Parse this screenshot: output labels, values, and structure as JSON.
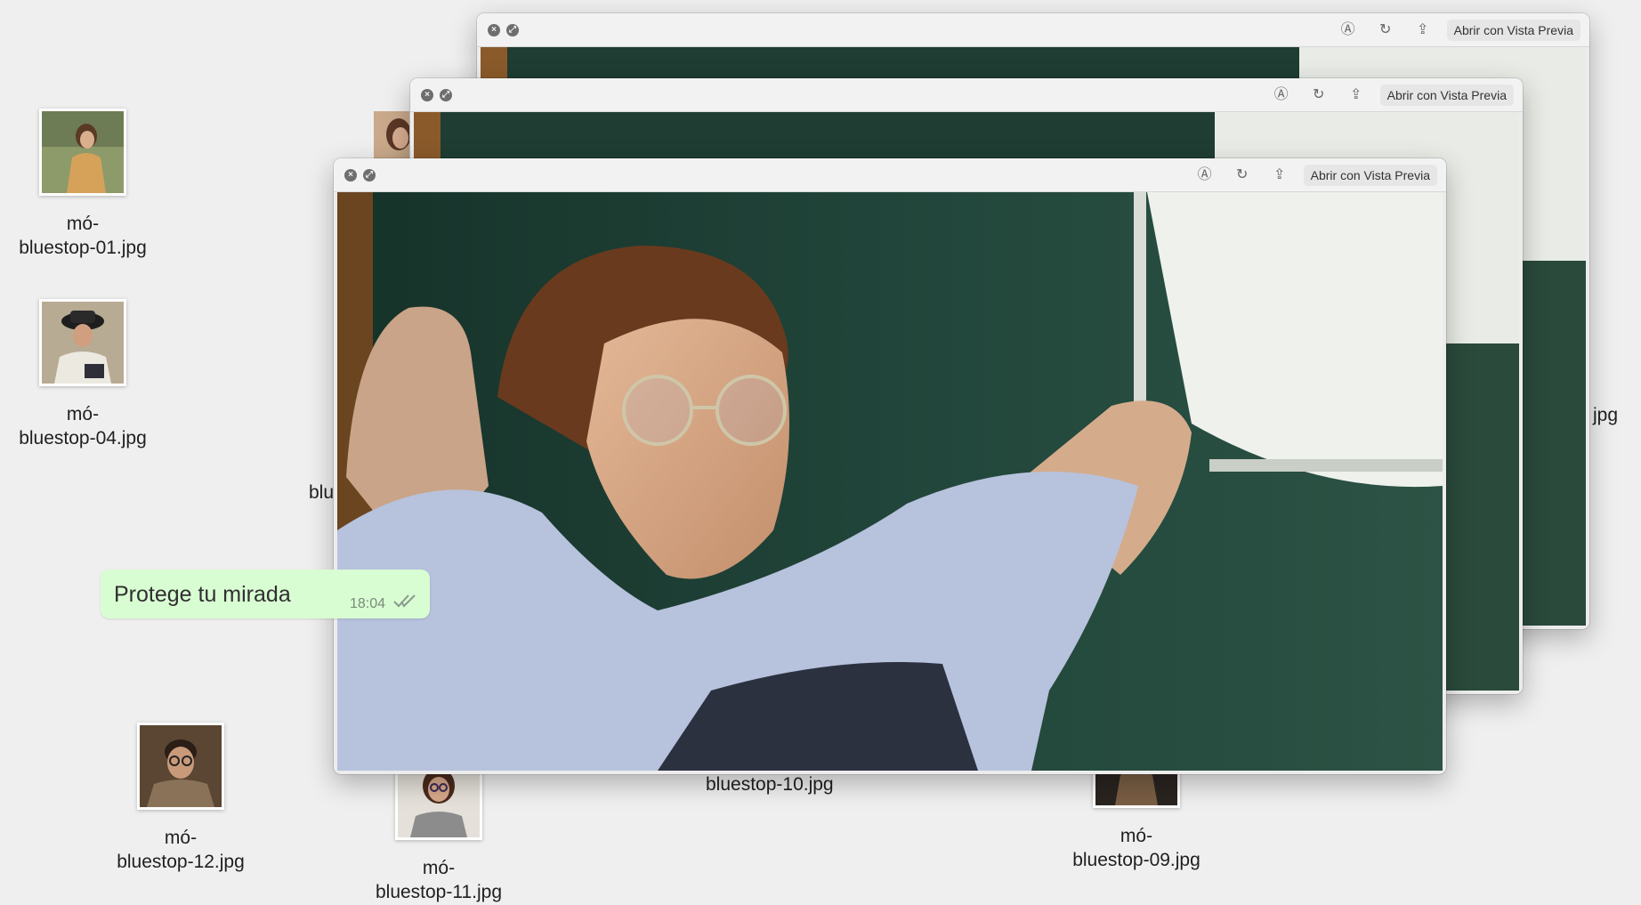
{
  "desktop": {
    "icons": [
      {
        "label_line1": "mó-",
        "label_line2": "bluestop-01.jpg"
      },
      {
        "label_line1": "mó-",
        "label_line2": "bluestop-04.jpg"
      },
      {
        "label_line1": "mó-",
        "label_line2": "bluestop-12.jpg"
      },
      {
        "label_line1": "mó-",
        "label_line2": "bluestop-11.jpg"
      },
      {
        "label_line1": "",
        "label_line2": "bluestop-10.jpg"
      },
      {
        "label_line1": "mó-",
        "label_line2": "bluestop-09.jpg"
      }
    ],
    "partial_label_left": "blu",
    "partial_label_right": "jpg"
  },
  "windows": [
    {
      "open_with_label": "Abrir con Vista Previa"
    },
    {
      "open_with_label": "Abrir con Vista Previa"
    },
    {
      "open_with_label": "Abrir con Vista Previa"
    }
  ],
  "chat": {
    "message": "Protege tu mirada",
    "time": "18:04"
  },
  "colors": {
    "bubble": "#d9fdd3",
    "desktop": "#efefef",
    "photo_bg": "#1f3d33"
  }
}
